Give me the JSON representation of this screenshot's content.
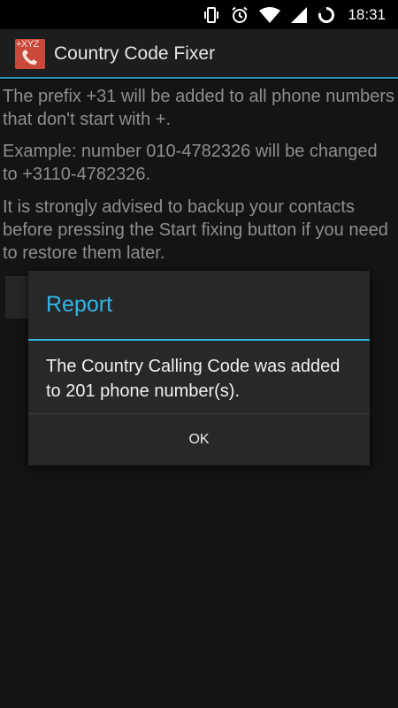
{
  "status_bar": {
    "time": "18:31",
    "icons": [
      "vibrate-icon",
      "alarm-icon",
      "wifi-icon",
      "cell-signal-icon",
      "battery-icon"
    ]
  },
  "action_bar": {
    "app_icon_text": "+XYZ",
    "title": "Country Code Fixer",
    "accent_color": "#2f8fb5"
  },
  "content": {
    "paragraphs": [
      "The prefix +31 will be added to all phone numbers that don't start with +.",
      "Example: number 010-4782326 will be changed to +3110-4782326.",
      "It is strongly advised to backup your contacts before pressing the Start fixing button if you need to restore them later."
    ]
  },
  "dialog": {
    "title": "Report",
    "message": "The Country Calling Code was added to 201 phone number(s).",
    "ok_label": "OK",
    "accent_color": "#33b5e5"
  }
}
